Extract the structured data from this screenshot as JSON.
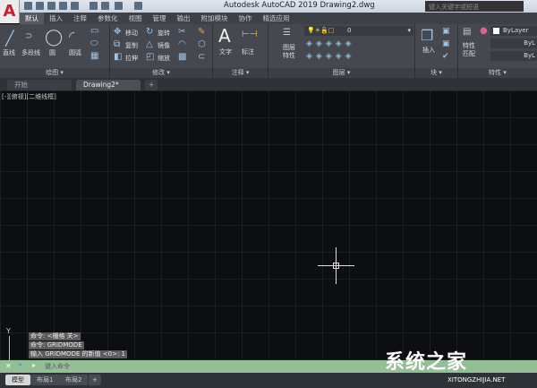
{
  "app": {
    "logo": "A",
    "title": "Autodesk AutoCAD 2019    Drawing2.dwg",
    "search_placeholder": "键入关键字或短语"
  },
  "menu_tabs": [
    "默认",
    "插入",
    "注释",
    "参数化",
    "视图",
    "管理",
    "输出",
    "附加模块",
    "协作",
    "精选应用"
  ],
  "ribbon": {
    "draw": {
      "title": "绘图 ▾",
      "tools": [
        "直线",
        "多段线",
        "圆",
        "圆弧"
      ]
    },
    "modify": {
      "title": "修改 ▾",
      "tools": [
        "移动",
        "旋转",
        "复制",
        "镜像",
        "拉伸",
        "缩放"
      ]
    },
    "annotation": {
      "title": "注释 ▾",
      "tools": [
        "文字",
        "标注"
      ]
    },
    "layers": {
      "title": "图层 ▾",
      "tool": "图层特性",
      "layer_value": "0"
    },
    "block": {
      "title": "块 ▾",
      "tool": "插入"
    },
    "properties": {
      "title": "特性 ▾",
      "tool": "特性匹配",
      "color": "ByLayer",
      "linetype": "ByL",
      "lineweight": "ByL"
    }
  },
  "doc_tabs": [
    "开始",
    "Drawing2*",
    "+"
  ],
  "view_label": "[-][俯视][二维线框]",
  "command_history": [
    "命令: <栅格 关>",
    "命令: GRIDMODE",
    "输入 GRIDMODE 的新值 <0>: 1"
  ],
  "command_placeholder": "键入命令",
  "ucs_label": "Y",
  "layout_tabs": [
    "模型",
    "布局1",
    "布局2",
    "+"
  ],
  "watermark": {
    "text": "系统之家",
    "url": "XITONGZHIJIA.NET"
  }
}
